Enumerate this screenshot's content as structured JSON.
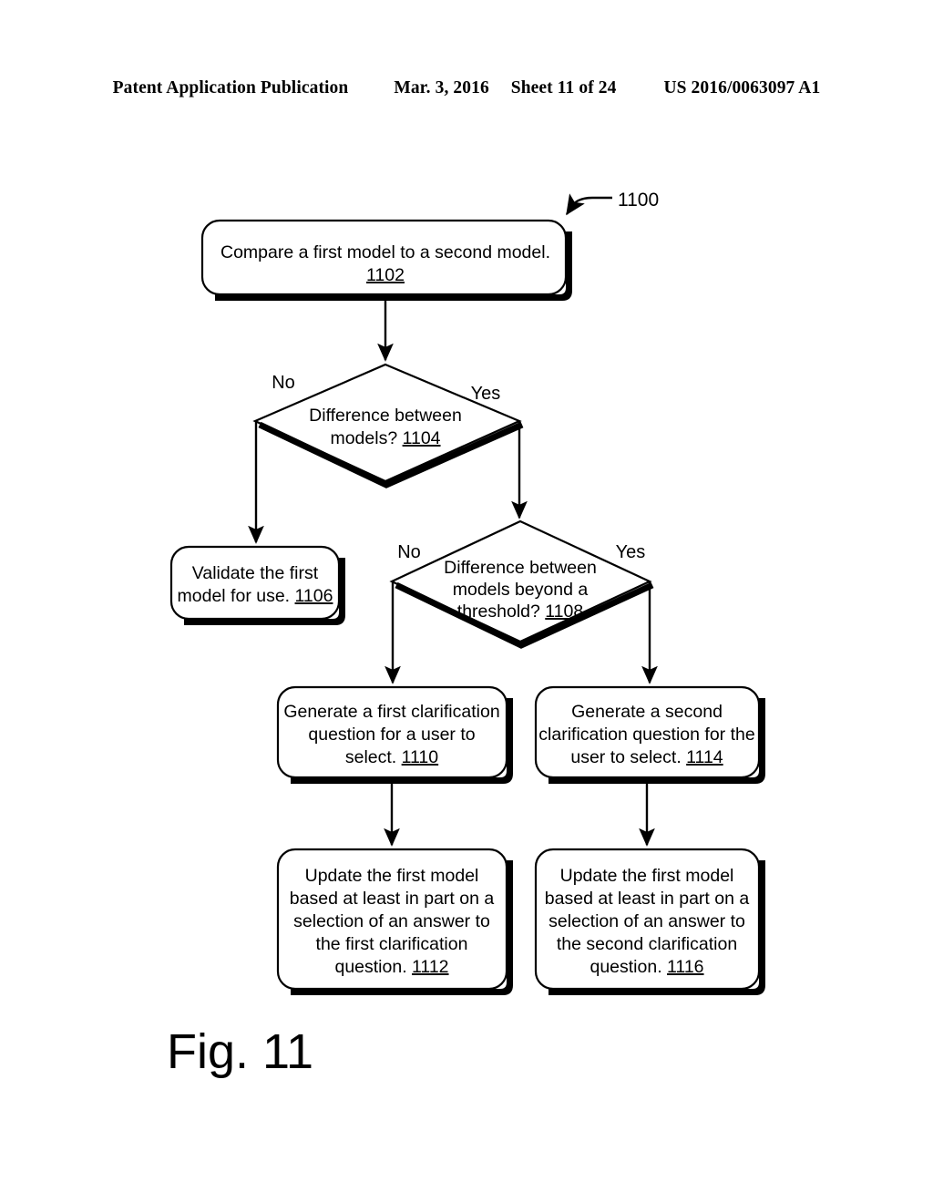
{
  "header": {
    "publication": "Patent Application Publication",
    "date": "Mar. 3, 2016",
    "sheet": "Sheet 11 of 24",
    "number": "US 2016/0063097 A1"
  },
  "figure": {
    "caption": "Fig. 11",
    "lead_label": "1100",
    "nodes": [
      {
        "id": "1102",
        "type": "process",
        "ref": "1102",
        "lines": [
          "Compare a first model to a second model.",
          "1102"
        ],
        "text": "Compare a first model to a second model. 1102"
      },
      {
        "id": "1104",
        "type": "decision",
        "ref": "1104",
        "lines": [
          "Difference between",
          "models? 1104"
        ],
        "text": "Difference between models? 1104",
        "branch_no": "No",
        "branch_yes": "Yes"
      },
      {
        "id": "1106",
        "type": "process",
        "ref": "1106",
        "lines": [
          "Validate the first",
          "model for use. 1106"
        ],
        "text": "Validate the first model for use. 1106"
      },
      {
        "id": "1108",
        "type": "decision",
        "ref": "1108",
        "lines": [
          "Difference between",
          "models beyond a",
          "threshold? 1108"
        ],
        "text": "Difference between models beyond a threshold? 1108",
        "branch_no": "No",
        "branch_yes": "Yes"
      },
      {
        "id": "1110",
        "type": "process",
        "ref": "1110",
        "lines": [
          "Generate a first clarification",
          "question for a user to",
          "select. 1110"
        ],
        "text": "Generate a first clarification question for a user to select. 1110"
      },
      {
        "id": "1114",
        "type": "process",
        "ref": "1114",
        "lines": [
          "Generate a second",
          "clarification question for the",
          "user to select. 1114"
        ],
        "text": "Generate a second clarification question for the user to select. 1114"
      },
      {
        "id": "1112",
        "type": "process",
        "ref": "1112",
        "lines": [
          "Update the first model",
          "based at least in part on a",
          "selection of an answer to",
          "the first clarification",
          "question. 1112"
        ],
        "text": "Update the first model based at least in part on a selection of an answer to the first clarification question. 1112"
      },
      {
        "id": "1116",
        "type": "process",
        "ref": "1116",
        "lines": [
          "Update the first model",
          "based at least in part on a",
          "selection of an answer to",
          "the second clarification",
          "question. 1116"
        ],
        "text": "Update the first model based at least in part on a selection of an answer to the second clarification question. 1116"
      }
    ],
    "node_text": {
      "n1102_l1": "Compare a first model to a second model.",
      "n1102_l2": "1102",
      "n1104_l1": "Difference between",
      "n1104_l2a": "models? ",
      "n1104_l2b": "1104",
      "n1104_no": "No",
      "n1104_yes": "Yes",
      "n1106_l1": "Validate the first",
      "n1106_l2a": "model for use. ",
      "n1106_l2b": "1106",
      "n1108_l1": "Difference between",
      "n1108_l2": "models beyond a",
      "n1108_l3a": "threshold? ",
      "n1108_l3b": "1108",
      "n1108_no": "No",
      "n1108_yes": "Yes",
      "n1110_l1": "Generate a first clarification",
      "n1110_l2": "question for a user to",
      "n1110_l3a": "select. ",
      "n1110_l3b": "1110",
      "n1114_l1": "Generate a second",
      "n1114_l2": "clarification question for the",
      "n1114_l3a": "user to select. ",
      "n1114_l3b": "1114",
      "n1112_l1": "Update the first model",
      "n1112_l2": "based at least in part on a",
      "n1112_l3": "selection of an answer to",
      "n1112_l4": "the first clarification",
      "n1112_l5a": "question. ",
      "n1112_l5b": "1112",
      "n1116_l1": "Update the first model",
      "n1116_l2": "based at least in part on a",
      "n1116_l3": "selection of an answer to",
      "n1116_l4": "the second clarification",
      "n1116_l5a": "question. ",
      "n1116_l5b": "1116"
    }
  },
  "colors": {
    "ink": "#000000",
    "paper": "#ffffff"
  }
}
